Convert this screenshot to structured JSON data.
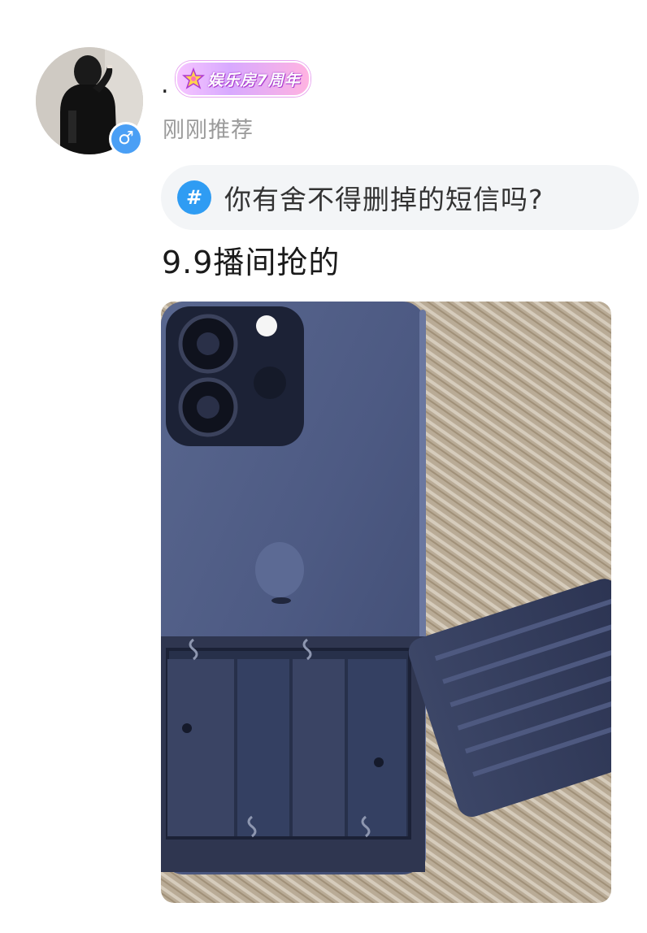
{
  "post": {
    "user_name": ".",
    "badge_text": "娱乐房7周年",
    "timestamp": "刚刚推荐",
    "topic_icon": "#",
    "topic_text": "你有舍不得删掉的短信吗?",
    "content_text": "9.9播间抢的",
    "gender_symbol": "♂",
    "gender_color": "#4a9ff5",
    "topic_icon_color": "#2f9cf3"
  },
  "icons": {
    "avatar": "avatar-photo",
    "gender": "male-icon",
    "badge": "star-badge-icon",
    "topic": "hashtag-icon"
  }
}
